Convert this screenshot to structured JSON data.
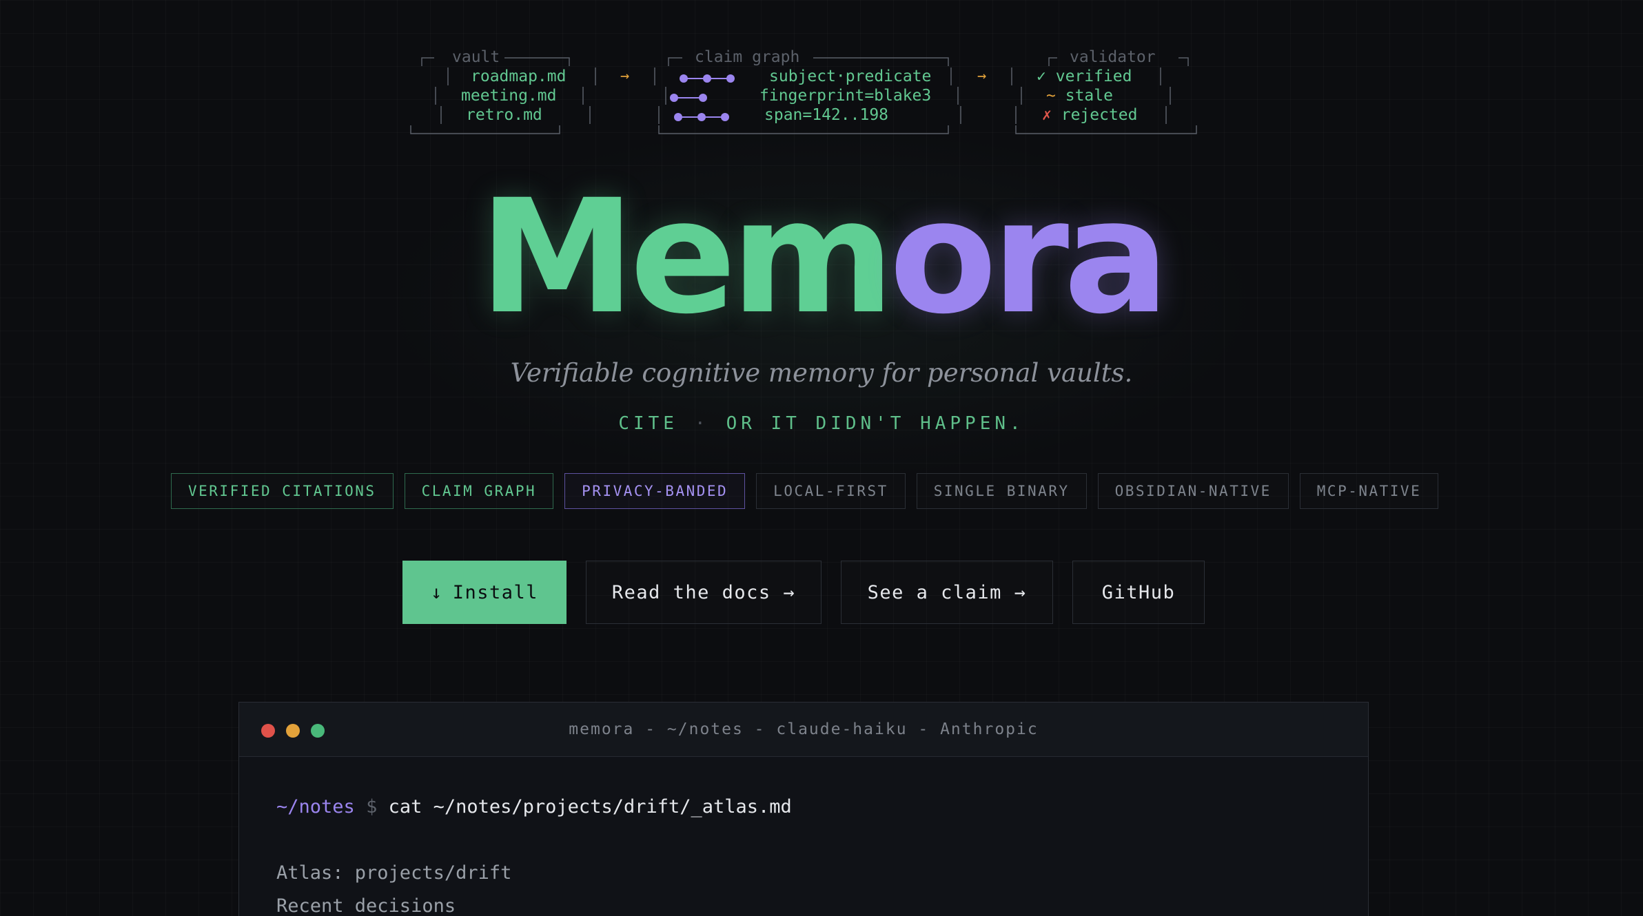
{
  "diagram": {
    "vault": {
      "title": "vault",
      "files": [
        "roadmap.md",
        "meeting.md",
        "retro.md"
      ]
    },
    "arrow": "→",
    "graph": {
      "title": "claim graph",
      "rows": [
        "subject·predicate",
        "fingerprint=blake3",
        "span=142..198"
      ]
    },
    "validator": {
      "title": "validator",
      "rows": [
        {
          "symbol": "✓",
          "label": "verified"
        },
        {
          "symbol": "~",
          "label": "stale"
        },
        {
          "symbol": "✗",
          "label": "rejected"
        }
      ]
    }
  },
  "hero": {
    "title_part1": "Mem",
    "title_part2": "ora",
    "subtitle": "Verifiable cognitive memory for personal vaults.",
    "motto_left": "CITE",
    "motto_sep": "·",
    "motto_right": "OR IT DIDN'T HAPPEN."
  },
  "tags": [
    {
      "label": "VERIFIED CITATIONS",
      "style": "green"
    },
    {
      "label": "CLAIM GRAPH",
      "style": "green"
    },
    {
      "label": "PRIVACY-BANDED",
      "style": "purple"
    },
    {
      "label": "LOCAL-FIRST",
      "style": "neutral"
    },
    {
      "label": "SINGLE BINARY",
      "style": "neutral"
    },
    {
      "label": "OBSIDIAN-NATIVE",
      "style": "neutral"
    },
    {
      "label": "MCP-NATIVE",
      "style": "neutral"
    }
  ],
  "actions": {
    "install_icon": "↓",
    "install": "Install",
    "docs": "Read the docs →",
    "claim": "See a claim →",
    "github": "GitHub"
  },
  "terminal": {
    "title": "memora - ~/notes - claude-haiku - Anthropic",
    "prompt_path": "~/notes",
    "prompt_sign": "$",
    "command": "cat ~/notes/projects/drift/_atlas.md",
    "output": [
      "Atlas: projects/drift",
      "Recent decisions"
    ]
  },
  "colors": {
    "green": "#5fcf94",
    "purple": "#9b85ef",
    "amber": "#e3a23a",
    "red": "#e0524a",
    "background": "#0c0d10"
  }
}
